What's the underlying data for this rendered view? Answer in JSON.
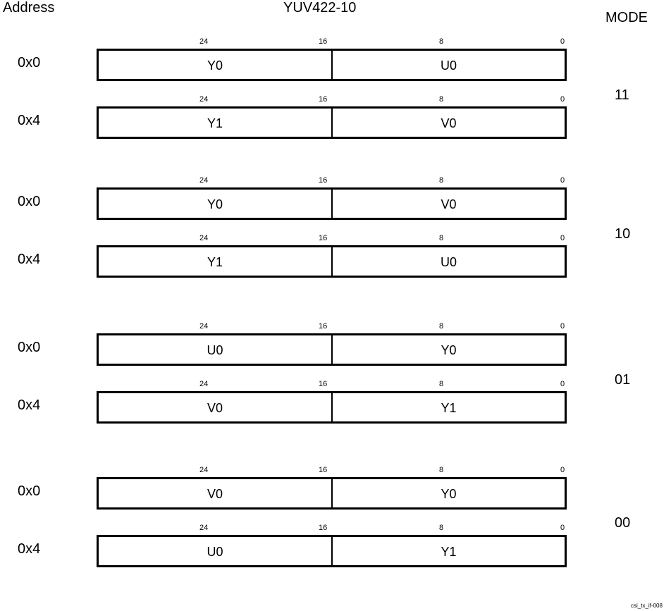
{
  "title": "YUV422-10",
  "address_header": "Address",
  "mode_header": "MODE",
  "footer": "csi_tx_if-008",
  "bit_labels": [
    "24",
    "16",
    "8",
    "0"
  ],
  "groups": [
    {
      "mode": "11",
      "rows": [
        {
          "address": "0x0",
          "high": "Y0",
          "low": "U0"
        },
        {
          "address": "0x4",
          "high": "Y1",
          "low": "V0"
        }
      ]
    },
    {
      "mode": "10",
      "rows": [
        {
          "address": "0x0",
          "high": "Y0",
          "low": "V0"
        },
        {
          "address": "0x4",
          "high": "Y1",
          "low": "U0"
        }
      ]
    },
    {
      "mode": "01",
      "rows": [
        {
          "address": "0x0",
          "high": "U0",
          "low": "Y0"
        },
        {
          "address": "0x4",
          "high": "V0",
          "low": "Y1"
        }
      ]
    },
    {
      "mode": "00",
      "rows": [
        {
          "address": "0x0",
          "high": "V0",
          "low": "Y0"
        },
        {
          "address": "0x4",
          "high": "U0",
          "low": "Y1"
        }
      ]
    }
  ]
}
